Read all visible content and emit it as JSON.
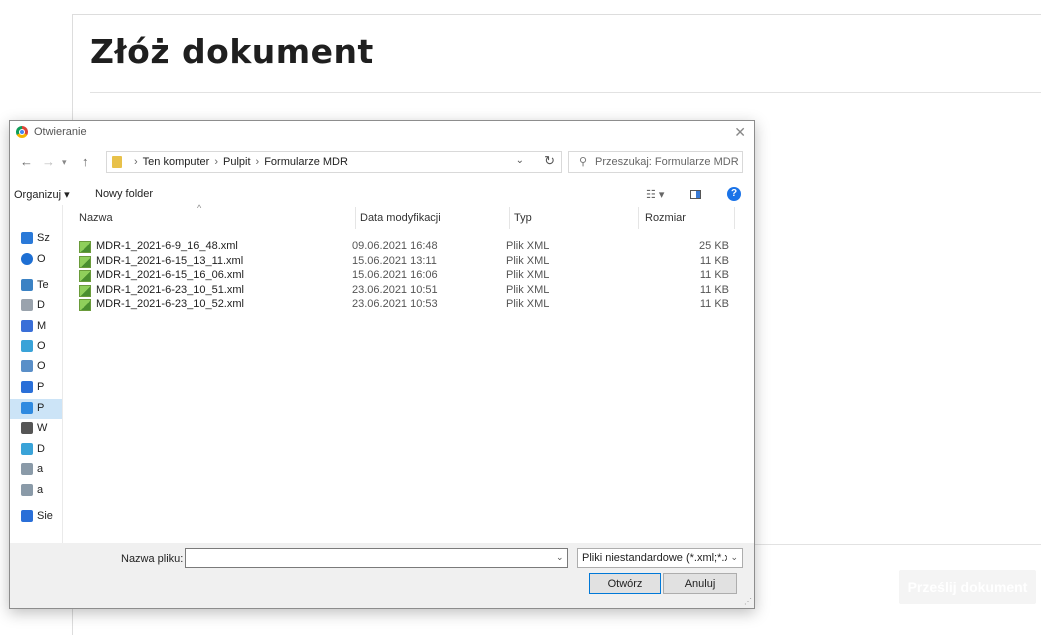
{
  "page": {
    "title": "Złóż dokument",
    "submit_label": "Prześlij dokument"
  },
  "dialog": {
    "title": "Otwieranie",
    "breadcrumbs": [
      "Ten komputer",
      "Pulpit",
      "Formularze MDR"
    ],
    "search_placeholder": "Przeszukaj: Formularze MDR",
    "toolbar": {
      "organize": "Organizuj",
      "new_folder": "Nowy folder"
    },
    "nav_items": [
      {
        "label": "Sz",
        "icon": "star-icon"
      },
      {
        "label": "O",
        "icon": "cloud-icon"
      },
      {
        "label": "Te",
        "icon": "computer-icon"
      },
      {
        "label": "D",
        "icon": "document-icon"
      },
      {
        "label": "M",
        "icon": "music-icon"
      },
      {
        "label": "O",
        "icon": "cube-icon"
      },
      {
        "label": "O",
        "icon": "desktop-icon"
      },
      {
        "label": "P",
        "icon": "download-icon"
      },
      {
        "label": "P",
        "icon": "monitor-icon"
      },
      {
        "label": "W",
        "icon": "video-icon"
      },
      {
        "label": "D",
        "icon": "drive-icon"
      },
      {
        "label": "a",
        "icon": "network-drive-icon"
      },
      {
        "label": "a",
        "icon": "network-drive-icon"
      },
      {
        "label": "Sie",
        "icon": "network-icon"
      }
    ],
    "columns": {
      "name": "Nazwa",
      "date": "Data modyfikacji",
      "type": "Typ",
      "size": "Rozmiar"
    },
    "files": [
      {
        "name": "MDR-1_2021-6-9_16_48.xml",
        "date": "09.06.2021 16:48",
        "type": "Plik XML",
        "size": "25 KB"
      },
      {
        "name": "MDR-1_2021-6-15_13_11.xml",
        "date": "15.06.2021 13:11",
        "type": "Plik XML",
        "size": "11 KB"
      },
      {
        "name": "MDR-1_2021-6-15_16_06.xml",
        "date": "15.06.2021 16:06",
        "type": "Plik XML",
        "size": "11 KB"
      },
      {
        "name": "MDR-1_2021-6-23_10_51.xml",
        "date": "23.06.2021 10:51",
        "type": "Plik XML",
        "size": "11 KB"
      },
      {
        "name": "MDR-1_2021-6-23_10_52.xml",
        "date": "23.06.2021 10:53",
        "type": "Plik XML",
        "size": "11 KB"
      }
    ],
    "filename_label": "Nazwa pliku:",
    "filename_value": "",
    "filetype_value": "Pliki niestandardowe (*.xml;*.xsd)",
    "open_label": "Otwórz",
    "cancel_label": "Anuluj"
  }
}
